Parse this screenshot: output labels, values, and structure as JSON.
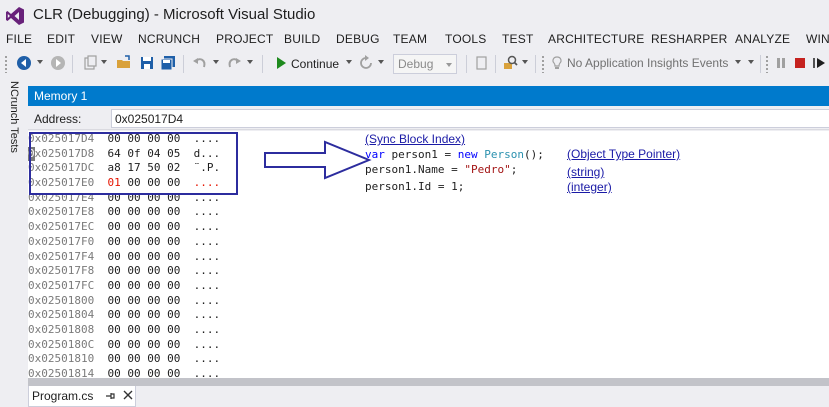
{
  "window": {
    "title": "CLR (Debugging) - Microsoft Visual Studio"
  },
  "menu": {
    "items": [
      {
        "label": "FILE"
      },
      {
        "label": "EDIT"
      },
      {
        "label": "VIEW"
      },
      {
        "label": "NCRUNCH"
      },
      {
        "label": "PROJECT"
      },
      {
        "label": "BUILD"
      },
      {
        "label": "DEBUG"
      },
      {
        "label": "TEAM"
      },
      {
        "label": "TOOLS"
      },
      {
        "label": "TEST"
      },
      {
        "label": "ARCHITECTURE"
      },
      {
        "label": "RESHARPER"
      },
      {
        "label": "ANALYZE"
      },
      {
        "label": "WIN"
      }
    ]
  },
  "toolbar": {
    "continue_label": "Continue",
    "configuration": "Debug",
    "insights_label": "No Application Insights Events",
    "icons": [
      "back-icon",
      "forward-icon",
      "new-project-icon",
      "open-icon",
      "save-icon",
      "save-all-icon",
      "undo-icon",
      "redo-icon",
      "play-icon",
      "refresh-icon",
      "find-icon",
      "insights-icon",
      "pause-icon",
      "stop-icon",
      "restart-icon"
    ],
    "colors": {
      "play": "#1e8a1e",
      "stop": "#c5221f",
      "accent": "#007acc"
    }
  },
  "side_panel": {
    "label": "NCrunch Tests"
  },
  "memory_window": {
    "title": "Memory 1",
    "address_label": "Address:",
    "address_value": "0x025017D4",
    "rows": [
      {
        "addr": "0x025017D4",
        "bytes": "00 00 00 00",
        "ascii": "...."
      },
      {
        "addr": "0x025017D8",
        "bytes": "64 0f 04 05",
        "ascii": "d..."
      },
      {
        "addr": "0x025017DC",
        "bytes": "a8 17 50 02",
        "ascii": "¨.P."
      },
      {
        "addr": "0x025017E0",
        "bytes_red": "01",
        "bytes": " 00 00 00",
        "ascii_red": "...."
      },
      {
        "addr": "0x025017E4",
        "bytes": "00 00 00 00",
        "ascii": "...."
      },
      {
        "addr": "0x025017E8",
        "bytes": "00 00 00 00",
        "ascii": "...."
      },
      {
        "addr": "0x025017EC",
        "bytes": "00 00 00 00",
        "ascii": "...."
      },
      {
        "addr": "0x025017F0",
        "bytes": "00 00 00 00",
        "ascii": "...."
      },
      {
        "addr": "0x025017F4",
        "bytes": "00 00 00 00",
        "ascii": "...."
      },
      {
        "addr": "0x025017F8",
        "bytes": "00 00 00 00",
        "ascii": "...."
      },
      {
        "addr": "0x025017FC",
        "bytes": "00 00 00 00",
        "ascii": "...."
      },
      {
        "addr": "0x02501800",
        "bytes": "00 00 00 00",
        "ascii": "...."
      },
      {
        "addr": "0x02501804",
        "bytes": "00 00 00 00",
        "ascii": "...."
      },
      {
        "addr": "0x02501808",
        "bytes": "00 00 00 00",
        "ascii": "...."
      },
      {
        "addr": "0x0250180C",
        "bytes": "00 00 00 00",
        "ascii": "...."
      },
      {
        "addr": "0x02501810",
        "bytes": "00 00 00 00",
        "ascii": "...."
      },
      {
        "addr": "0x02501814",
        "bytes": "00 00 00 00",
        "ascii": "...."
      }
    ]
  },
  "annotations": {
    "sync_block": "(Sync Block Index)",
    "object_type": "(Object Type Pointer)",
    "string": "(string)",
    "integer": "(integer)",
    "code": {
      "line1": {
        "kw1": "var",
        "mid1": " person1 = ",
        "kw2": "new",
        "sp": " ",
        "type": "Person",
        "end": "();"
      },
      "line2": {
        "prefix": "person1.Name = ",
        "str": "\"Pedro\"",
        "end": ";"
      },
      "line3": {
        "text": "person1.Id = 1;"
      }
    },
    "colors": {
      "box": "#2c2c9e",
      "link": "#1a1aa6",
      "keyword": "#0000ff",
      "type": "#2b91af",
      "string": "#a31515",
      "changed_byte": "#e51400"
    }
  },
  "document_tabs": [
    {
      "label": "Program.cs"
    }
  ]
}
